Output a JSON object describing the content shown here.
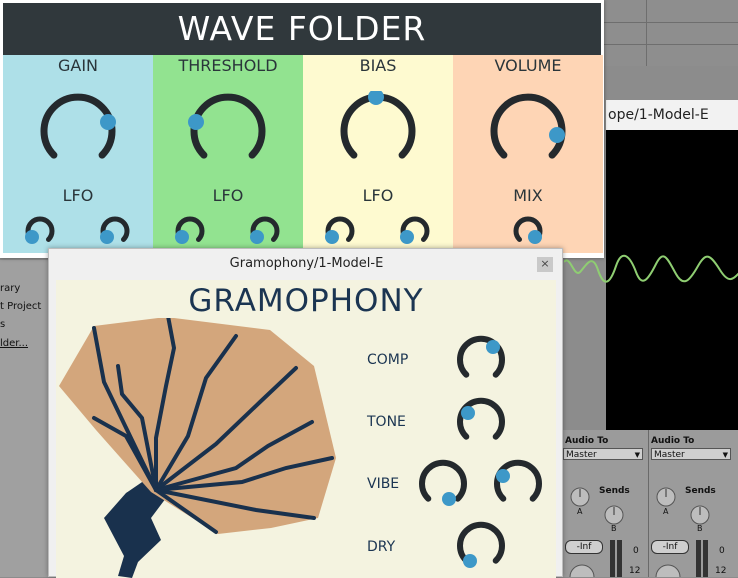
{
  "colors": {
    "knob_dark": "#24292d",
    "knob_dot": "#3d98c8",
    "gain_bg": "#aee0e8",
    "threshold_bg": "#92e390",
    "bias_bg": "#fefad0",
    "volume_bg": "#fed5b5",
    "title_bar": "#30383c",
    "gramophony_bg": "#f4f3e0",
    "horn_fill": "#d3a67c",
    "horn_line": "#19314d",
    "scope_wave": "#8fce72"
  },
  "wave_folder": {
    "title": "WAVE FOLDER",
    "columns": [
      {
        "label": "GAIN",
        "sub_label": "LFO"
      },
      {
        "label": "THRESHOLD",
        "sub_label": "LFO"
      },
      {
        "label": "BIAS",
        "sub_label": "LFO"
      },
      {
        "label": "VOLUME",
        "sub_label": "MIX"
      }
    ]
  },
  "scope": {
    "title": "ope/1-Model-E"
  },
  "gramophony": {
    "window_title": "Gramophony/1-Model-E",
    "close_label": "×",
    "heading": "GRAMOPHONY",
    "controls": [
      {
        "label": "COMP"
      },
      {
        "label": "TONE"
      },
      {
        "label": "VIBE"
      },
      {
        "label": "DRY"
      }
    ]
  },
  "browser": {
    "items": [
      "rary",
      "t Project",
      "s",
      "lder..."
    ]
  },
  "mixer": {
    "channels": [
      {
        "audio_to_label": "Audio To",
        "route": "Master",
        "sends_label": "Sends",
        "send_a": "A",
        "send_b": "B",
        "volume": "-Inf",
        "meter_0": "0",
        "meter_12": "12"
      },
      {
        "audio_to_label": "Audio To",
        "route": "Master",
        "sends_label": "Sends",
        "send_a": "A",
        "send_b": "B",
        "volume": "-Inf",
        "meter_0": "0",
        "meter_12": "12"
      }
    ]
  }
}
